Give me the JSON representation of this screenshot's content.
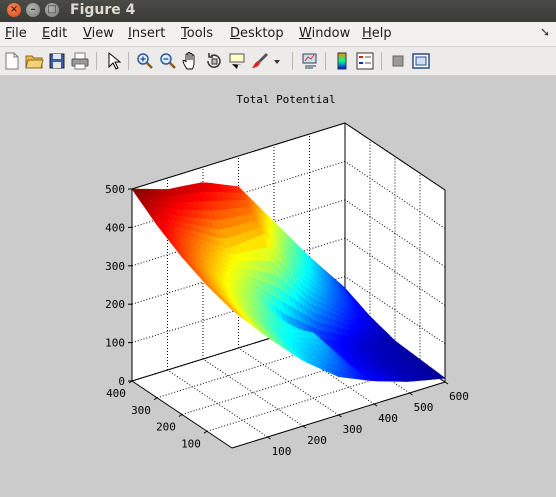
{
  "window": {
    "title": "Figure 4"
  },
  "menubar": [
    {
      "label": "File",
      "mnemonic": "F",
      "rest": "ile"
    },
    {
      "label": "Edit",
      "mnemonic": "E",
      "rest": "dit"
    },
    {
      "label": "View",
      "mnemonic": "V",
      "rest": "iew"
    },
    {
      "label": "Insert",
      "mnemonic": "I",
      "rest": "nsert"
    },
    {
      "label": "Tools",
      "mnemonic": "T",
      "rest": "ools"
    },
    {
      "label": "Desktop",
      "mnemonic": "D",
      "rest": "esktop"
    },
    {
      "label": "Window",
      "mnemonic": "W",
      "rest": "indow"
    },
    {
      "label": "Help",
      "mnemonic": "H",
      "rest": "elp"
    }
  ],
  "toolbar": {
    "icons": [
      "new-figure-icon",
      "open-file-icon",
      "save-icon",
      "print-icon",
      "pointer-icon",
      "zoom-in-icon",
      "zoom-out-icon",
      "pan-icon",
      "rotate-3d-icon",
      "data-cursor-icon",
      "brush-icon",
      "dropdown-arrow-icon",
      "link-plot-icon",
      "colorbar-icon",
      "legend-icon",
      "hide-plot-tools-icon",
      "show-plot-tools-icon"
    ]
  },
  "chart_data": {
    "type": "surface",
    "title": "Total Potential",
    "xlabel": "",
    "ylabel": "",
    "zlabel": "",
    "x_ticks": [
      100,
      200,
      300,
      400,
      500,
      600
    ],
    "y_ticks": [
      100,
      200,
      300,
      400
    ],
    "z_ticks": [
      0,
      100,
      200,
      300,
      400,
      500
    ],
    "xlim": [
      0,
      600
    ],
    "ylim": [
      0,
      400
    ],
    "zlim": [
      0,
      500
    ],
    "grid": true,
    "colormap": "jet",
    "x": [
      0,
      100,
      200,
      300,
      400,
      500,
      600
    ],
    "y": [
      0,
      100,
      200,
      300,
      400
    ],
    "z": [
      [
        360,
        260,
        170,
        100,
        60,
        30,
        10
      ],
      [
        380,
        290,
        200,
        170,
        60,
        30,
        15
      ],
      [
        410,
        330,
        260,
        140,
        80,
        40,
        20
      ],
      [
        450,
        390,
        330,
        340,
        200,
        110,
        40
      ],
      [
        500,
        470,
        460,
        420,
        300,
        180,
        70
      ]
    ]
  }
}
